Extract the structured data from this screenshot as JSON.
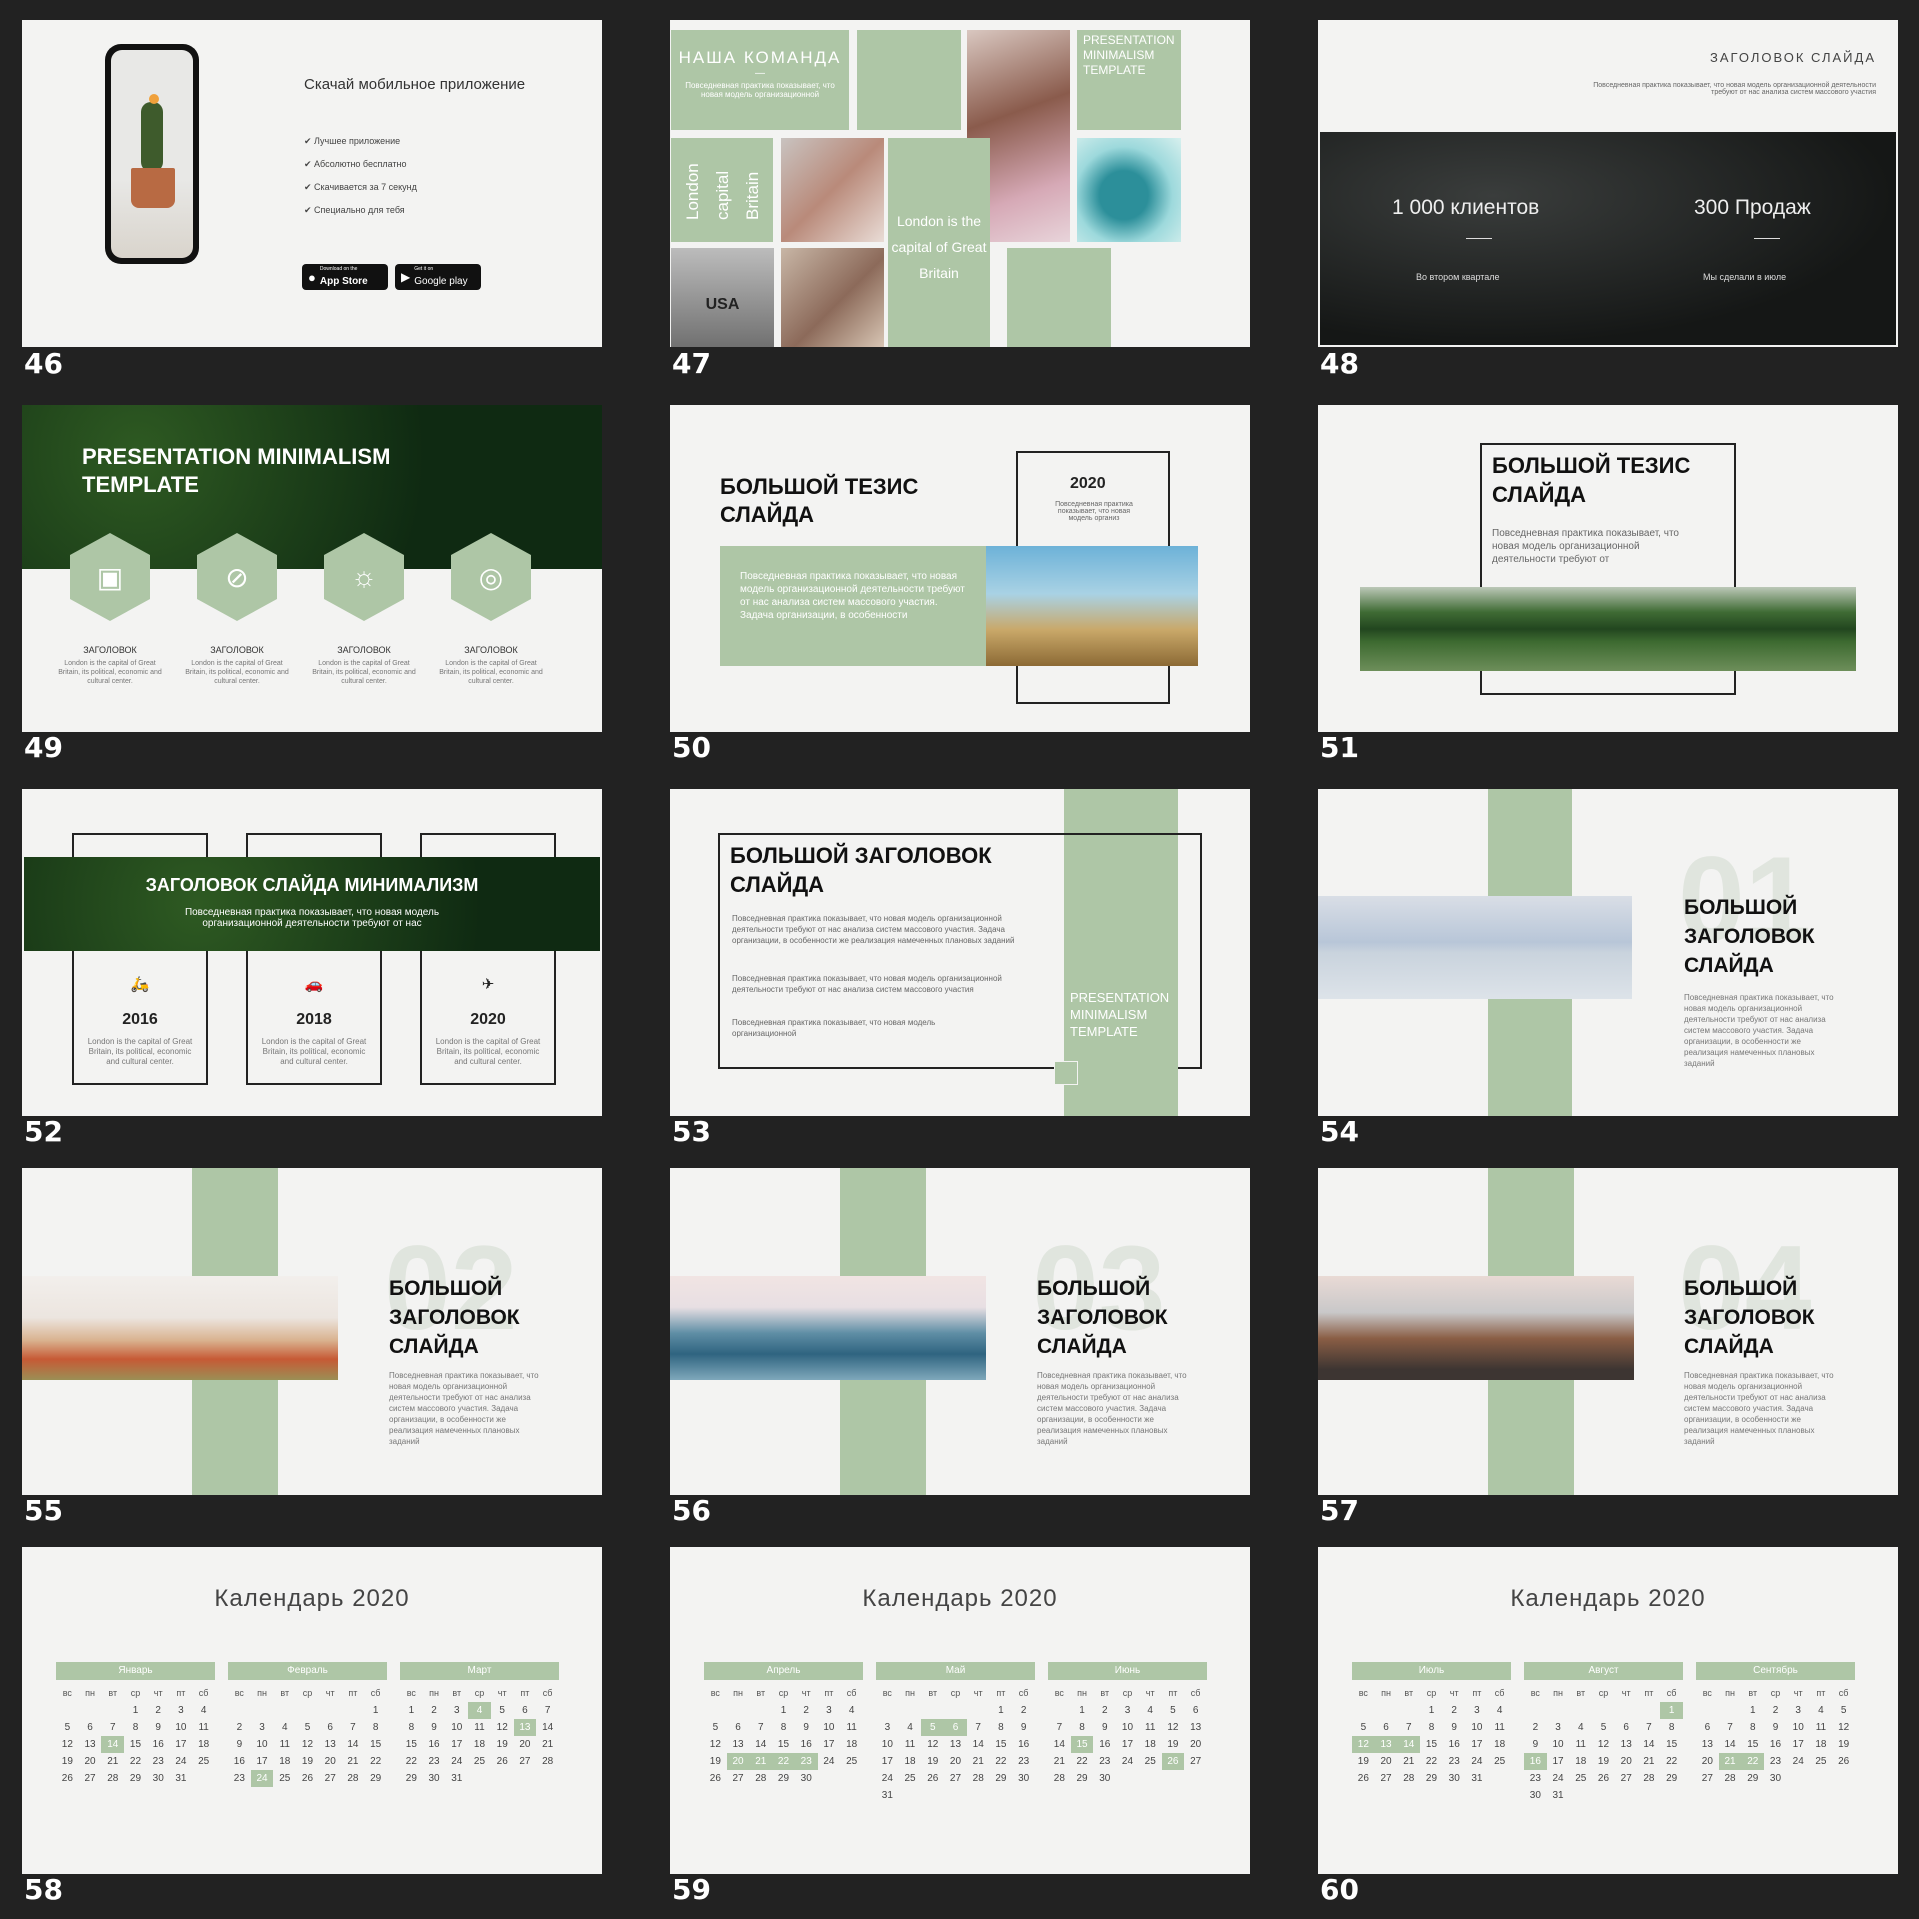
{
  "colors": {
    "accent": "#aec6a6",
    "background": "#222222",
    "slide": "#f3f3f2",
    "dark_green": "#0f2a12"
  },
  "slide_numbers": [
    "46",
    "47",
    "48",
    "49",
    "50",
    "51",
    "52",
    "53",
    "54",
    "55",
    "56",
    "57",
    "58",
    "59",
    "60"
  ],
  "s46": {
    "title": "Скачай мобильное приложение",
    "items": [
      "Лучшее приложение",
      "Абсолютно бесплатно",
      "Скачивается за 7 секунд",
      "Специально для тебя"
    ],
    "appstore_small": "Download on the",
    "appstore": "App Store",
    "gplay_small": "Get it on",
    "gplay": "Google play"
  },
  "s47": {
    "title": "НАША КОМАНДА",
    "dash": "—",
    "sub": "Повседневная практика показывает, что новая модель организационной",
    "vert1": "London",
    "vert2": "capital",
    "vert3": "Britain",
    "mid": "London is the capital of Great Britain",
    "pm": "PRESENTATION MINIMALISM TEMPLATE",
    "usa": "USA"
  },
  "s48": {
    "title": "ЗАГОЛОВОК СЛАЙДА",
    "sub": "Повседневная практика показывает, что новая модель организационной деятельности требуют от нас анализа систем массового участия",
    "stat1": "1 000 клиентов",
    "cap1": "Во втором квартале",
    "stat2": "300 Продаж",
    "cap2": "Мы сделали в июле"
  },
  "s49": {
    "title": "PRESENTATION MINIMALISM TEMPLATE",
    "items": [
      {
        "h": "ЗАГОЛОВОК",
        "p": "London is the capital of Great Britain, its political, economic and cultural center.",
        "icon": "backpack-icon"
      },
      {
        "h": "ЗАГОЛОВОК",
        "p": "London is the capital of Great Britain, its political, economic and cultural center.",
        "icon": "ping-pong-icon"
      },
      {
        "h": "ЗАГОЛОВОК",
        "p": "London is the capital of Great Britain, its political, economic and cultural center.",
        "icon": "lightbulb-icon"
      },
      {
        "h": "ЗАГОЛОВОК",
        "p": "London is the capital of Great Britain, its political, economic and cultural center.",
        "icon": "target-icon"
      }
    ]
  },
  "s50": {
    "title": "БОЛЬШОЙ ТЕЗИС СЛАЙДА",
    "year": "2020",
    "yearsub": "Повседневная практика показывает, что новая модель организ",
    "body": "Повседневная практика показывает, что новая модель организационной деятельности требуют от нас анализа систем массового участия. Задача организации, в особенности"
  },
  "s51": {
    "title": "БОЛЬШОЙ ТЕЗИС СЛАЙДА",
    "body": "Повседневная практика показывает, что новая модель организационной деятельности требуют от"
  },
  "s52": {
    "title": "ЗАГОЛОВОК СЛАЙДА МИНИМАЛИЗМ",
    "sub": "Повседневная практика показывает, что новая модель организационной деятельности требуют от нас",
    "cols": [
      {
        "year": "2016",
        "p": "London is the capital of Great Britain, its political, economic and cultural center.",
        "icon": "scooter-icon"
      },
      {
        "year": "2018",
        "p": "London is the capital of Great Britain, its political, economic and cultural center.",
        "icon": "car-icon"
      },
      {
        "year": "2020",
        "p": "London is the capital of Great Britain, its political, economic and cultural center.",
        "icon": "helicopter-icon"
      }
    ]
  },
  "s53": {
    "title": "БОЛЬШОЙ ЗАГОЛОВОК СЛАЙДА",
    "p1": "Повседневная практика показывает, что новая модель организационной деятельности требуют от нас анализа систем массового участия. Задача организации, в особенности же реализация намеченных плановых заданий",
    "p2": "Повседневная практика показывает, что новая модель организационной деятельности требуют от нас анализа систем массового участия",
    "p3": "Повседневная практика показывает, что новая модель организационной",
    "pm": "PRESENTATION MINIMALISM TEMPLATE"
  },
  "s54": {
    "num": "01",
    "title": "БОЛЬШОЙ ЗАГОЛОВОК СЛАЙДА",
    "body": "Повседневная практика показывает, что новая модель организационной деятельности требуют от нас анализа систем массового участия. Задача организации, в особенности же реализация намеченных плановых заданий"
  },
  "s55": {
    "num": "02",
    "title": "БОЛЬШОЙ ЗАГОЛОВОК СЛАЙДА",
    "body": "Повседневная практика показывает, что новая модель организационной деятельности требуют от нас анализа систем массового участия. Задача организации, в особенности же реализация намеченных плановых заданий"
  },
  "s56": {
    "num": "03",
    "title": "БОЛЬШОЙ ЗАГОЛОВОК СЛАЙДА",
    "body": "Повседневная практика показывает, что новая модель организационной деятельности требуют от нас анализа систем массового участия. Задача организации, в особенности же реализация намеченных плановых заданий"
  },
  "s57": {
    "num": "04",
    "title": "БОЛЬШОЙ ЗАГОЛОВОК СЛАЙДА",
    "body": "Повседневная практика показывает, что новая модель организационной деятельности требуют от нас анализа систем массового участия. Задача организации, в особенности же реализация намеченных плановых заданий"
  },
  "weekdays": [
    "вс",
    "пн",
    "вт",
    "ср",
    "чт",
    "пт",
    "сб"
  ],
  "calendars": [
    {
      "title": "Календарь 2020",
      "months": [
        {
          "name": "Январь",
          "offset": 3,
          "days": 31,
          "hl": [
            14
          ]
        },
        {
          "name": "Февраль",
          "offset": 6,
          "days": 29,
          "hl": [
            24
          ]
        },
        {
          "name": "Март",
          "offset": 0,
          "days": 31,
          "hl": [
            4,
            13
          ]
        }
      ]
    },
    {
      "title": "Календарь 2020",
      "months": [
        {
          "name": "Апрель",
          "offset": 3,
          "days": 30,
          "hl": [
            20,
            21,
            22,
            23
          ]
        },
        {
          "name": "Май",
          "offset": 5,
          "days": 31,
          "hl": [
            5,
            6
          ]
        },
        {
          "name": "Июнь",
          "offset": 1,
          "days": 30,
          "hl": [
            15,
            26
          ]
        }
      ]
    },
    {
      "title": "Календарь 2020",
      "months": [
        {
          "name": "Июль",
          "offset": 3,
          "days": 31,
          "hl": [
            12,
            13,
            14
          ]
        },
        {
          "name": "Август",
          "offset": 6,
          "days": 31,
          "hl": [
            1,
            16
          ]
        },
        {
          "name": "Сентябрь",
          "offset": 2,
          "days": 30,
          "hl": [
            21,
            22
          ]
        }
      ]
    }
  ]
}
